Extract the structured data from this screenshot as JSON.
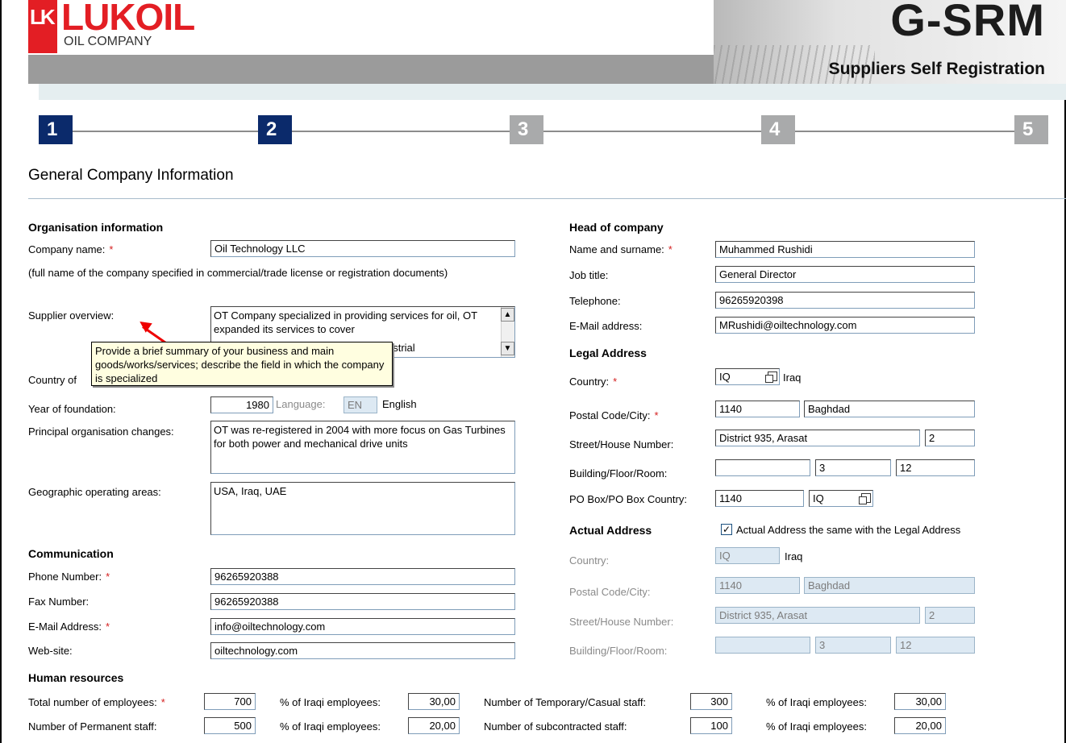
{
  "header": {
    "logo_mark": "LK",
    "logo_name": "LUKOIL",
    "logo_sub": "OIL COMPANY",
    "app_name": "G-SRM",
    "app_subtitle": "Suppliers Self Registration"
  },
  "steps": [
    "1",
    "2",
    "3",
    "4",
    "5"
  ],
  "active_steps": [
    "1",
    "2"
  ],
  "page_title": "General Company Information",
  "org": {
    "section": "Organisation information",
    "company_name_label": "Company name:",
    "company_name_value": "Oil Technology LLC",
    "company_name_hint": "(full name of the company specified in commercial/trade license or registration documents)",
    "overview_label": "Supplier overview:",
    "overview_value": "OT Company specialized in providing services for oil, OT expanded its services to cover",
    "overview_visible_tail": "ustrial",
    "country_label": "Country of",
    "year_label": "Year of foundation:",
    "year_value": "1980",
    "language_label": "Language:",
    "language_code": "EN",
    "language_name": "English",
    "changes_label": "Principal organisation changes:",
    "changes_value": "OT was re-registered in 2004 with more focus on Gas Turbines for both power and mechanical drive units",
    "areas_label": "Geographic operating areas:",
    "areas_value": "USA, Iraq, UAE"
  },
  "tooltip": "Provide a brief summary of your business and main goods/works/services; describe the field in which the company is specialized",
  "communication": {
    "section": "Communication",
    "phone_label": "Phone Number:",
    "phone_value": "96265920388",
    "fax_label": "Fax Number:",
    "fax_value": "96265920388",
    "email_label": "E-Mail Address:",
    "email_value": "info@oiltechnology.com",
    "web_label": "Web-site:",
    "web_value": "oiltechnology.com"
  },
  "head": {
    "section": "Head of company",
    "name_label": "Name and surname:",
    "name_value": "Muhammed Rushidi",
    "job_label": "Job title:",
    "job_value": "General Director",
    "tel_label": "Telephone:",
    "tel_value": "96265920398",
    "email_label": "E-Mail address:",
    "email_value": "MRushidi@oiltechnology.com"
  },
  "legal": {
    "section": "Legal Address",
    "country_label": "Country:",
    "country_code": "IQ",
    "country_name": "Iraq",
    "postal_label": "Postal Code/City:",
    "postal_value": "1140",
    "city_value": "Baghdad",
    "street_label": "Street/House Number:",
    "street_value": "District 935, Arasat",
    "house_value": "2",
    "building_label": "Building/Floor/Room:",
    "building_value": "",
    "floor_value": "3",
    "room_value": "12",
    "pobox_label": "PO Box/PO Box Country:",
    "pobox_value": "1140",
    "pobox_country": "IQ"
  },
  "actual": {
    "section": "Actual Address",
    "same_checkbox_label": "Actual Address the same with the Legal Address",
    "same_checked": true,
    "check_mark": "✓",
    "country_label": "Country:",
    "country_code": "IQ",
    "country_name": "Iraq",
    "postal_label": "Postal Code/City:",
    "postal_value": "1140",
    "city_value": "Baghdad",
    "street_label": "Street/House Number:",
    "street_value": "District 935, Arasat",
    "house_value": "2",
    "building_label": "Building/Floor/Room:",
    "building_value": "",
    "floor_value": "3",
    "room_value": "12"
  },
  "hr": {
    "section": "Human resources",
    "total_label": "Total number of employees:",
    "total_value": "700",
    "pct_label": "% of Iraqi employees:",
    "total_pct": "30,00",
    "temp_label": "Number of Temporary/Casual staff:",
    "temp_value": "300",
    "temp_pct": "30,00",
    "perm_label": "Number of Permanent staff:",
    "perm_value": "500",
    "perm_pct": "20,00",
    "sub_label": "Number of subcontracted staff:",
    "sub_value": "100",
    "sub_pct": "20,00"
  },
  "required_mark": "*",
  "colors": {
    "accent": "#0b2a6b",
    "required": "#d42020",
    "brand_red": "#e31e24"
  }
}
